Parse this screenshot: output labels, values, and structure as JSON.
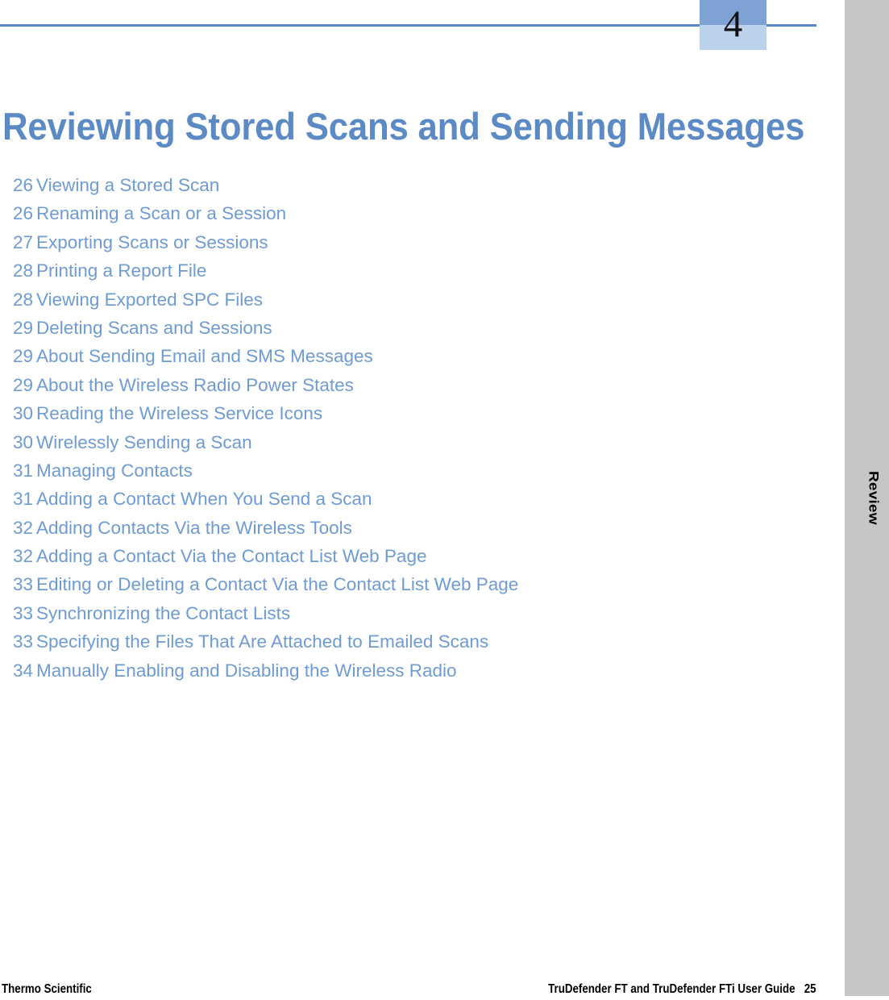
{
  "chapter": {
    "number": "4",
    "title": "Reviewing Stored Scans and Sending Messages"
  },
  "side_tab": {
    "label": "Review"
  },
  "toc": {
    "entries": [
      {
        "page": "26",
        "title": "Viewing a Stored Scan"
      },
      {
        "page": "26",
        "title": "Renaming a Scan or a Session"
      },
      {
        "page": "27",
        "title": "Exporting Scans or Sessions"
      },
      {
        "page": "28",
        "title": "Printing a Report File"
      },
      {
        "page": "28",
        "title": "Viewing Exported SPC Files"
      },
      {
        "page": "29",
        "title": "Deleting Scans and Sessions"
      },
      {
        "page": "29",
        "title": "About Sending Email and SMS Messages"
      },
      {
        "page": "29",
        "title": "About the Wireless Radio Power States"
      },
      {
        "page": "30",
        "title": "Reading the Wireless Service Icons"
      },
      {
        "page": "30",
        "title": "Wirelessly Sending a Scan"
      },
      {
        "page": "31",
        "title": "Managing Contacts"
      },
      {
        "page": "31",
        "title": "Adding a Contact When You Send a Scan"
      },
      {
        "page": "32",
        "title": "Adding Contacts Via the Wireless Tools"
      },
      {
        "page": "32",
        "title": "Adding a Contact Via the Contact List Web Page"
      },
      {
        "page": "33",
        "title": "Editing or Deleting a Contact Via the Contact List Web Page"
      },
      {
        "page": "33",
        "title": "Synchronizing the Contact Lists"
      },
      {
        "page": "33",
        "title": "Specifying the Files That Are Attached to Emailed Scans"
      },
      {
        "page": "34",
        "title": "Manually Enabling and Disabling the Wireless Radio"
      }
    ]
  },
  "footer": {
    "left": "Thermo Scientific",
    "guide": "TruDefender FT and TruDefender FTi User Guide",
    "page_number": "25"
  },
  "colors": {
    "rule_blue": "#5686c6",
    "title_blue": "#5b8ac4",
    "toc_blue": "#6e9bd2",
    "badge_top": "#7fa2d4",
    "badge_bottom": "#bcd2ea",
    "side_tab_gray": "#c6c6c6"
  }
}
